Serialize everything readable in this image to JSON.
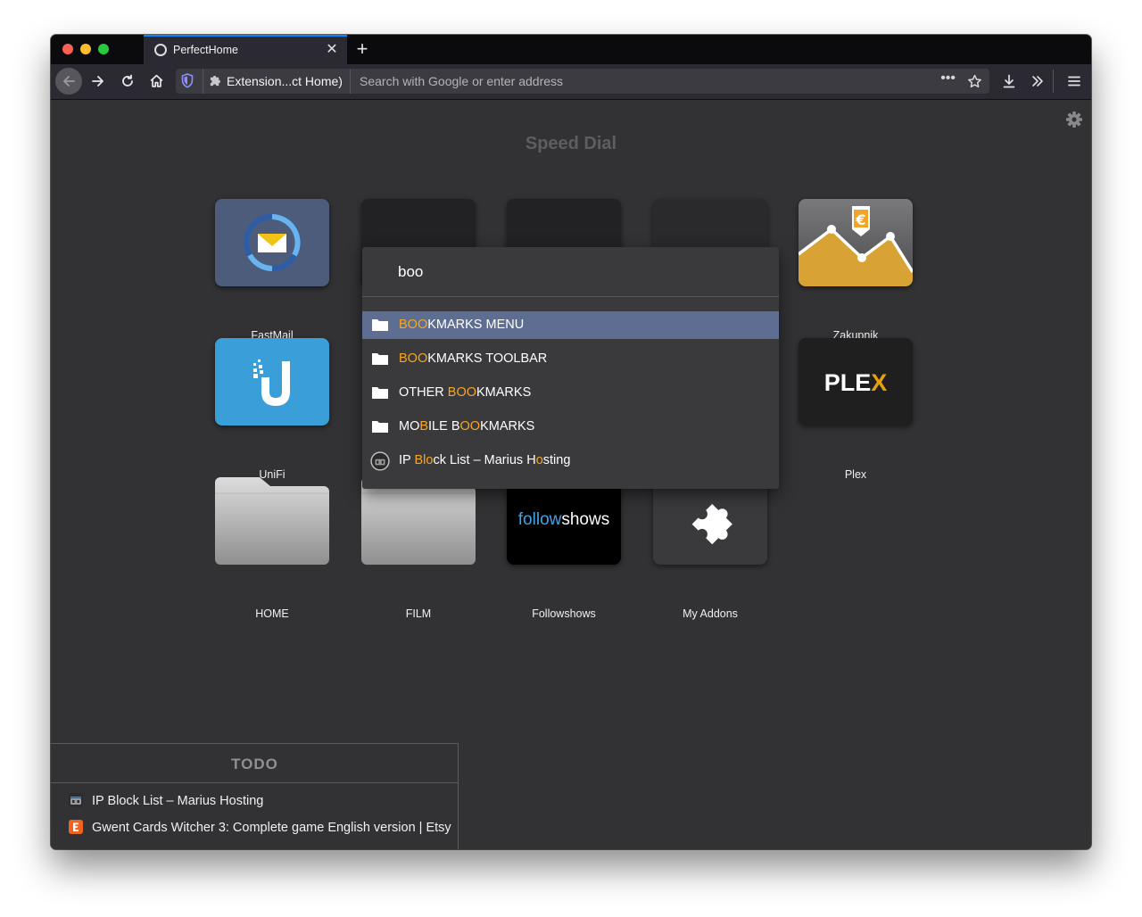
{
  "tab": {
    "title": "PerfectHome",
    "close_glyph": "✕",
    "new_glyph": "+"
  },
  "urlbar": {
    "extension_label": "Extension...ct Home)",
    "placeholder": "Search with Google or enter address",
    "dots": "•••"
  },
  "icons": [
    "back-arrow-icon",
    "forward-arrow-icon",
    "reload-icon",
    "home-icon",
    "shield-icon",
    "puzzle-icon",
    "star-icon",
    "download-icon",
    "chevron-double-right-icon",
    "hamburger-menu-icon",
    "gear-icon",
    "folder-icon"
  ],
  "page": {
    "title": "Speed Dial"
  },
  "tiles": {
    "fastmail": "FastMail",
    "zakupnik": "Zakupnik",
    "unifi": "UniFi",
    "plex": "Plex",
    "plex_logo_a": "PLE",
    "plex_logo_b": "X",
    "home": "HOME",
    "film": "FILM",
    "followshows": "Followshows",
    "followshows_logo_a": "follow",
    "followshows_logo_b": "shows",
    "addons": "My Addons"
  },
  "dropdown": {
    "query": "boo",
    "items": [
      {
        "parts": [
          "BOO",
          "KMARKS MENU"
        ]
      },
      {
        "parts": [
          "BOO",
          "KMARKS TOOLBAR"
        ]
      },
      {
        "parts": [
          "OTHER ",
          "BOO",
          "KMARKS"
        ]
      },
      {
        "parts": [
          "MO",
          "B",
          "ILE B",
          "OO",
          "KMARKS"
        ]
      },
      {
        "parts": [
          "IP ",
          "Bl",
          "o",
          "ck List – Marius H",
          "o",
          "sting"
        ]
      }
    ]
  },
  "todo": {
    "heading": "TODO",
    "items": [
      "IP Block List – Marius Hosting",
      "Gwent Cards Witcher 3: Complete game English version | Etsy"
    ]
  },
  "colors": {
    "highlight": "#f6a623",
    "selected_row": "#5d6e92",
    "accent_tab": "#0a84ff"
  }
}
